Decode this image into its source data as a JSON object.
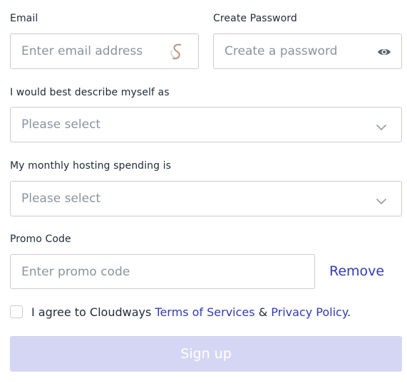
{
  "email": {
    "label": "Email",
    "placeholder": "Enter email address",
    "autofill_icon": "autofill-s-icon"
  },
  "password": {
    "label": "Create Password",
    "placeholder": "Create a password",
    "toggle_icon": "eye-icon"
  },
  "describe": {
    "label": "I would best describe myself as",
    "placeholder": "Please select",
    "icon": "chevron-down-icon"
  },
  "spending": {
    "label": "My monthly hosting spending is",
    "placeholder": "Please select",
    "icon": "chevron-down-icon"
  },
  "promo": {
    "label": "Promo Code",
    "placeholder": "Enter promo code",
    "remove_label": "Remove"
  },
  "agree": {
    "prefix": "I agree to Cloudways",
    "terms_link": "Terms of Services",
    "amp": "&",
    "privacy_link": "Privacy Policy",
    "suffix": "."
  },
  "submit": {
    "label": "Sign up"
  },
  "colors": {
    "link": "#2f3bb3",
    "button_bg": "#d5d6f3",
    "button_text": "#ffffff",
    "border": "#c7cbd1"
  }
}
